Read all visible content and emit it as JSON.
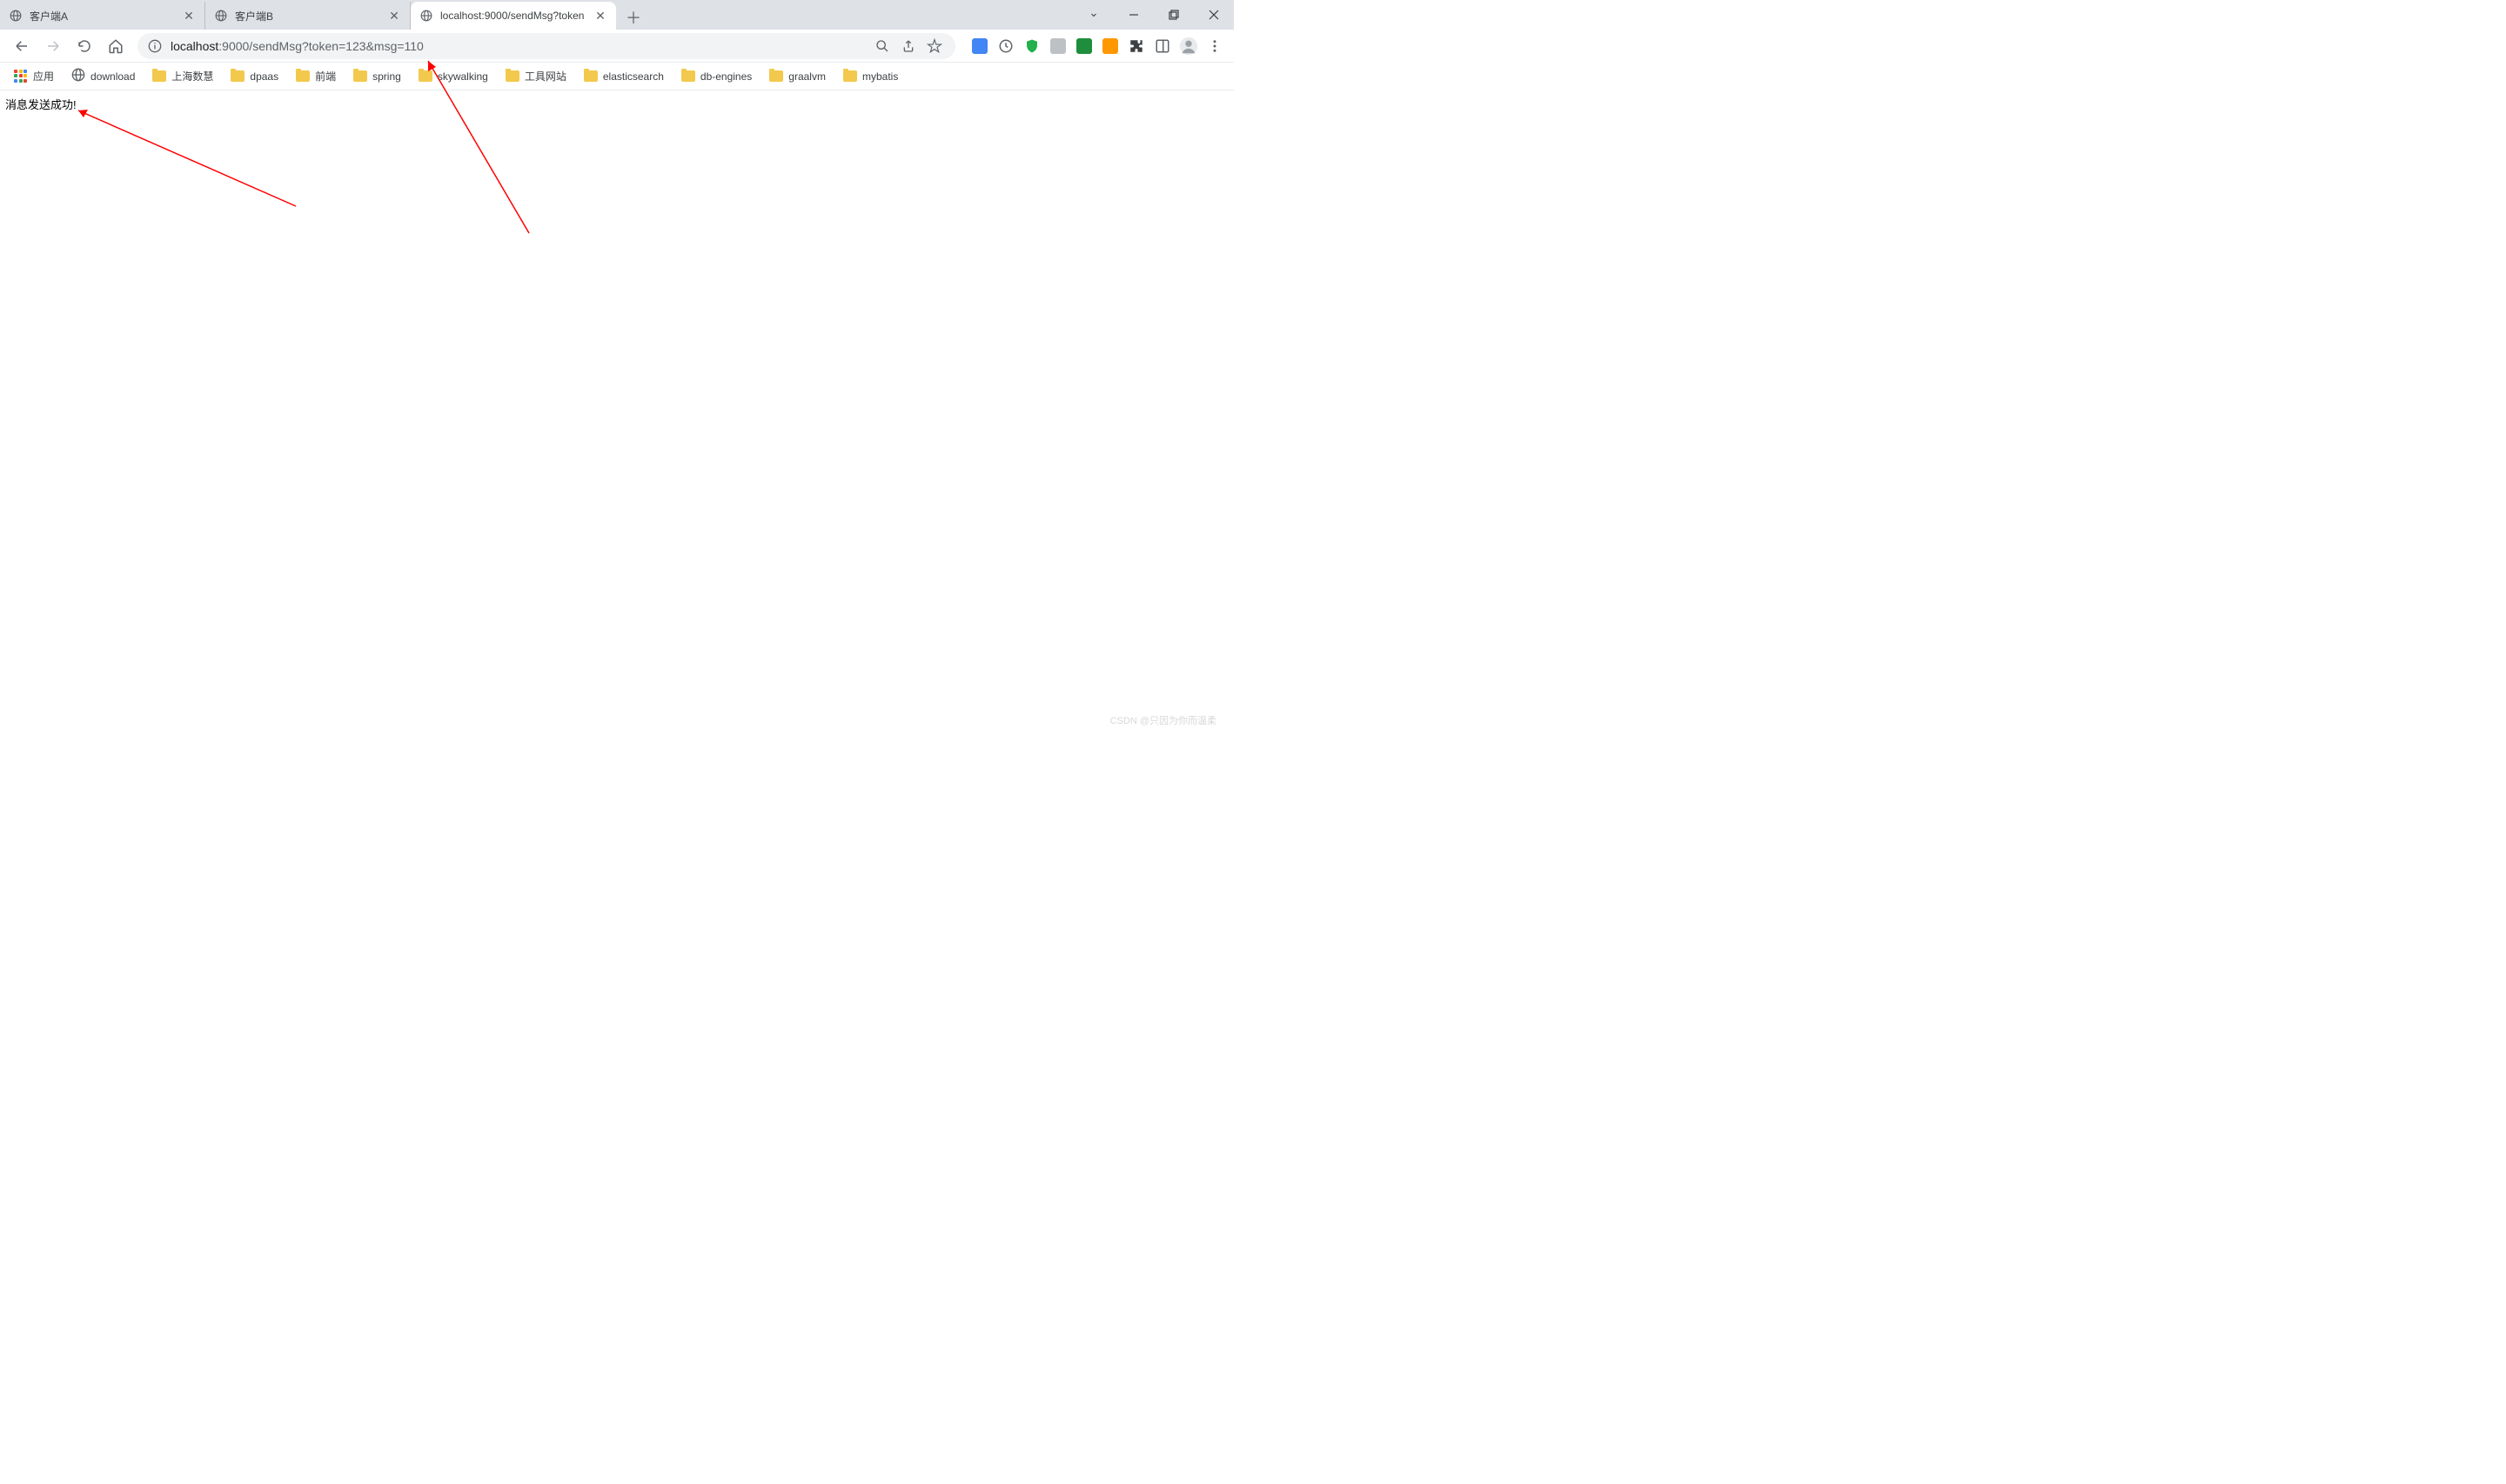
{
  "tabs": [
    {
      "title": "客户端A",
      "active": false
    },
    {
      "title": "客户端B",
      "active": false
    },
    {
      "title": "localhost:9000/sendMsg?token",
      "active": true
    }
  ],
  "url": {
    "host": "localhost",
    "rest": ":9000/sendMsg?token=123&msg=110"
  },
  "bookmarks": {
    "apps_label": "应用",
    "items": [
      {
        "type": "link",
        "label": "download"
      },
      {
        "type": "folder",
        "label": "上海数慧"
      },
      {
        "type": "folder",
        "label": "dpaas"
      },
      {
        "type": "folder",
        "label": "前端"
      },
      {
        "type": "folder",
        "label": "spring"
      },
      {
        "type": "folder",
        "label": "skywalking"
      },
      {
        "type": "folder",
        "label": "工具网站"
      },
      {
        "type": "folder",
        "label": "elasticsearch"
      },
      {
        "type": "folder",
        "label": "db-engines"
      },
      {
        "type": "folder",
        "label": "graalvm"
      },
      {
        "type": "folder",
        "label": "mybatis"
      }
    ]
  },
  "page_body": "消息发送成功!",
  "watermark": "CSDN @只因为你而温柔"
}
